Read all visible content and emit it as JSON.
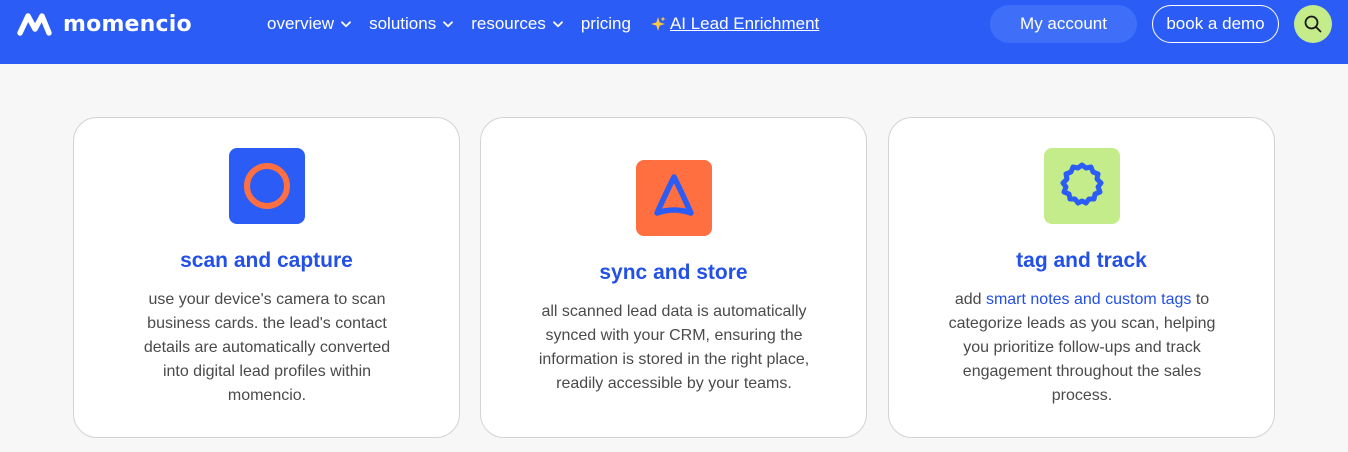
{
  "brand": {
    "name": "momencio",
    "logo_icon": "momencio-logo-icon",
    "primary_color": "#2b5cf6",
    "accent_green": "#c4ec8a",
    "accent_orange": "#ff6f3f"
  },
  "nav": {
    "items": [
      {
        "label": "overview",
        "has_dropdown": true
      },
      {
        "label": "solutions",
        "has_dropdown": true
      },
      {
        "label": "resources",
        "has_dropdown": true
      },
      {
        "label": "pricing",
        "has_dropdown": false
      }
    ],
    "highlight": {
      "label": "AI Lead Enrichment",
      "icon": "sparkle-icon"
    },
    "my_account_label": "My account",
    "book_demo_label": "book a demo",
    "search_icon": "search-icon"
  },
  "features": [
    {
      "icon": "circle-icon",
      "title": "scan and capture",
      "description": "use your device's camera to scan business cards. the lead's contact details are automatically converted into digital lead profiles within momencio."
    },
    {
      "icon": "rounded-triangle-icon",
      "title": "sync and store",
      "description": "all scanned lead data is automatically synced with your CRM, ensuring the information is stored in the right place, readily accessible by your teams."
    },
    {
      "icon": "badge-icon",
      "title": "tag and track",
      "description_before": "add ",
      "description_highlight": "smart notes and custom tags",
      "description_after": " to categorize leads as you scan, helping you prioritize follow-ups and track engagement throughout the sales process."
    }
  ]
}
